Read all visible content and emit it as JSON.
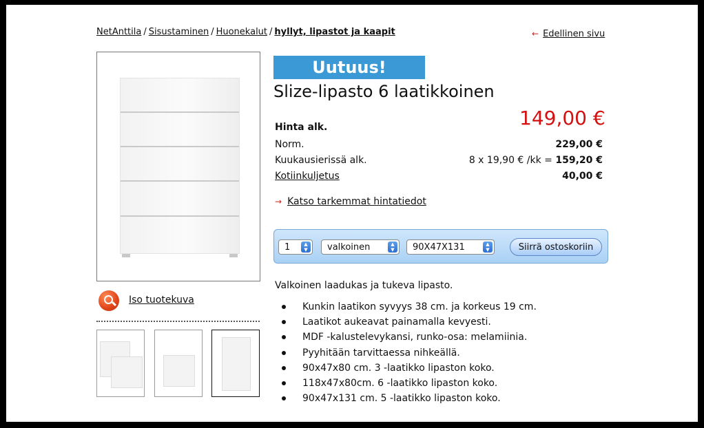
{
  "breadcrumb": {
    "items": [
      "NetAnttila",
      "Sisustaminen",
      "Huonekalut"
    ],
    "current": "hyllyt, lipastot ja kaapit"
  },
  "prev_link": "Edellinen sivu",
  "product": {
    "badge": "Uutuus!",
    "title": "Slize-lipasto 6 laatikkoinen",
    "price_label": "Hinta alk.",
    "price_main": "149,00 €",
    "rows": [
      {
        "label": "Norm.",
        "value": "229,00 €"
      },
      {
        "label": "Kuukausierissä alk.",
        "prefix": "8 x 19,90 € /kk = ",
        "value": "159,20 €"
      },
      {
        "label": "Kotiinkuljetus",
        "value": "40,00 €"
      }
    ],
    "details_link": "Katso tarkemmat hintatiedot"
  },
  "cart": {
    "quantity": "1",
    "color": "valkoinen",
    "size": "90X47X131",
    "button": "Siirrä ostoskoriin"
  },
  "images": {
    "zoom_link": "Iso tuotekuva"
  },
  "description": {
    "intro": "Valkoinen laadukas ja tukeva lipasto.",
    "bullets": [
      "Kunkin laatikon syvyys 38 cm. ja korkeus 19 cm.",
      "Laatikot aukeavat painamalla kevyesti.",
      "MDF -kalustelevykansi, runko-osa: melamiinia.",
      "Pyyhitään tarvittaessa nihkeällä.",
      "90x47x80 cm. 3 -laatikko lipaston koko.",
      "118x47x80cm. 6 -laatikko lipaston koko.",
      "90x47x131 cm. 5 -laatikko lipaston koko."
    ]
  },
  "colors": {
    "badge_bg": "#3b9ad6",
    "price_red": "#d41111",
    "arrow_red": "#cc2222"
  }
}
